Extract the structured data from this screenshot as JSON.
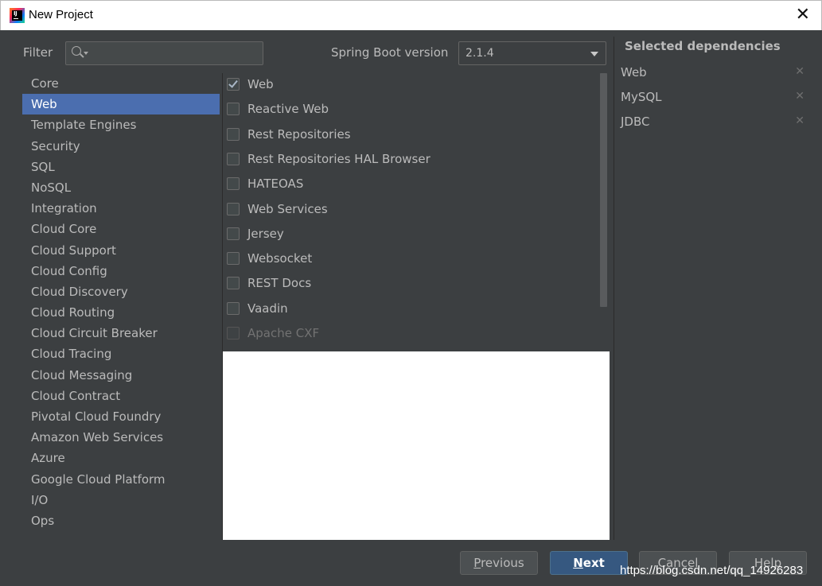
{
  "window": {
    "title": "New Project"
  },
  "filter": {
    "label": "Filter",
    "value": ""
  },
  "spring_boot": {
    "label": "Spring Boot version",
    "selected": "2.1.4"
  },
  "categories": [
    "Core",
    "Web",
    "Template Engines",
    "Security",
    "SQL",
    "NoSQL",
    "Integration",
    "Cloud Core",
    "Cloud Support",
    "Cloud Config",
    "Cloud Discovery",
    "Cloud Routing",
    "Cloud Circuit Breaker",
    "Cloud Tracing",
    "Cloud Messaging",
    "Cloud Contract",
    "Pivotal Cloud Foundry",
    "Amazon Web Services",
    "Azure",
    "Google Cloud Platform",
    "I/O",
    "Ops"
  ],
  "selected_category": "Web",
  "dependencies": [
    {
      "label": "Web",
      "checked": true,
      "enabled": true
    },
    {
      "label": "Reactive Web",
      "checked": false,
      "enabled": true
    },
    {
      "label": "Rest Repositories",
      "checked": false,
      "enabled": true
    },
    {
      "label": "Rest Repositories HAL Browser",
      "checked": false,
      "enabled": true
    },
    {
      "label": "HATEOAS",
      "checked": false,
      "enabled": true
    },
    {
      "label": "Web Services",
      "checked": false,
      "enabled": true
    },
    {
      "label": "Jersey",
      "checked": false,
      "enabled": true
    },
    {
      "label": "Websocket",
      "checked": false,
      "enabled": true
    },
    {
      "label": "REST Docs",
      "checked": false,
      "enabled": true
    },
    {
      "label": "Vaadin",
      "checked": false,
      "enabled": true
    },
    {
      "label": "Apache CXF",
      "checked": false,
      "enabled": false
    }
  ],
  "selected_dependencies": {
    "title": "Selected dependencies",
    "items": [
      "Web",
      "MySQL",
      "JDBC"
    ],
    "remove_glyph": "✕"
  },
  "buttons": {
    "previous": {
      "mnemonic": "P",
      "rest": "revious"
    },
    "next": {
      "mnemonic": "N",
      "rest": "ext"
    },
    "cancel": {
      "label": "Cancel"
    },
    "help": {
      "label": "Help"
    }
  },
  "watermark": "https://blog.csdn.net/qq_14926283",
  "colors": {
    "background": "#3c3f41",
    "selection": "#4b6eaf",
    "primary_button": "#365880",
    "text": "#bbbbbb"
  }
}
